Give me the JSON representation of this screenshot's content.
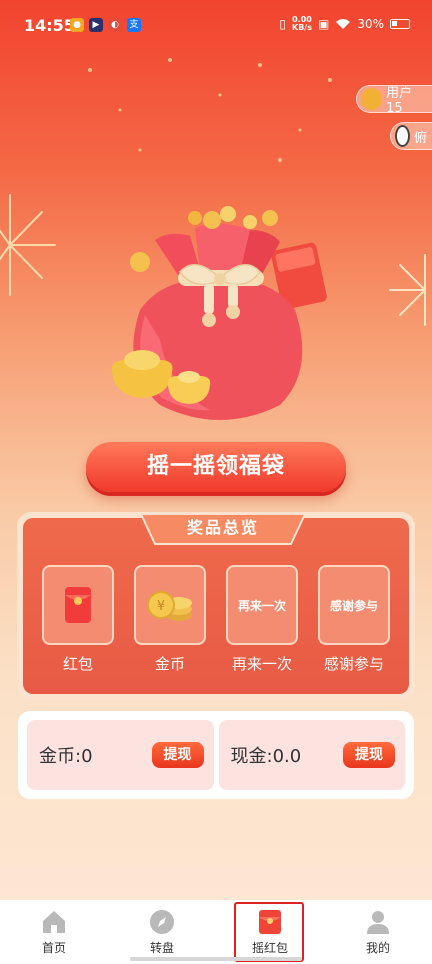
{
  "status_bar": {
    "time": "14:55",
    "net_speed_value": "0.00",
    "net_speed_unit": "KB/s",
    "battery": "30%"
  },
  "user_chips": [
    "用户15",
    "俯"
  ],
  "shake_button": "摇一摇领福袋",
  "prize_overview": {
    "title": "奖品总览",
    "items": [
      {
        "label": "红包",
        "icon": "red-envelope-icon"
      },
      {
        "label": "金币",
        "icon": "coins-icon"
      },
      {
        "label": "再来一次",
        "tile_text": "再来一次"
      },
      {
        "label": "感谢参与",
        "tile_text": "感谢参与"
      }
    ]
  },
  "balance": {
    "coins_label": "金币:0",
    "cash_label": "现金:0.0",
    "withdraw": "提现"
  },
  "bottom_nav": [
    {
      "label": "首页",
      "icon": "home-icon"
    },
    {
      "label": "转盘",
      "icon": "compass-icon"
    },
    {
      "label": "摇红包",
      "icon": "red-envelope-icon",
      "active": true
    },
    {
      "label": "我的",
      "icon": "user-icon"
    }
  ],
  "colors": {
    "accent": "#f0392c",
    "active_outline": "#e0221f"
  }
}
